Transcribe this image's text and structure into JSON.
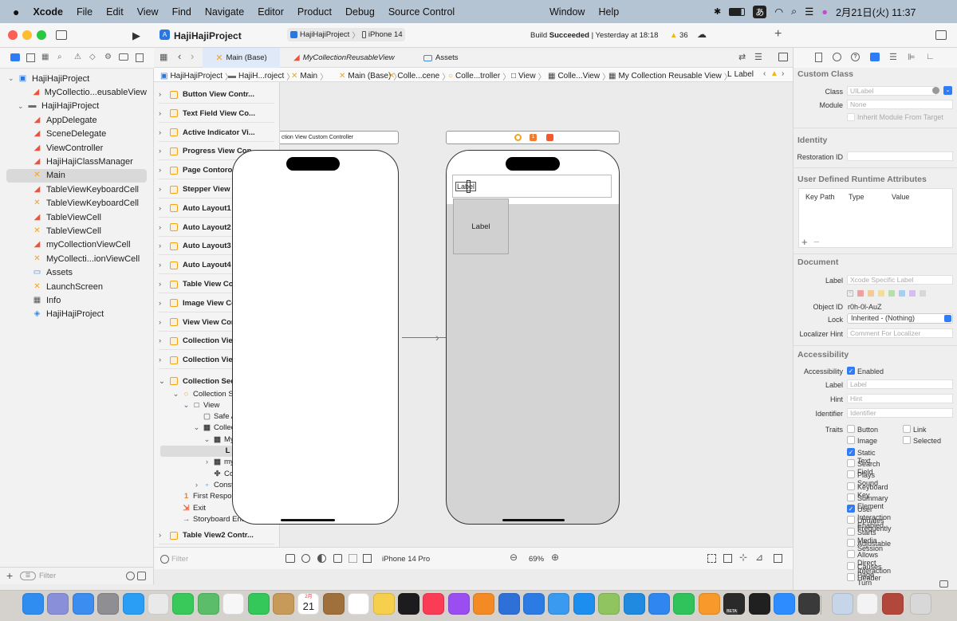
{
  "menubar": {
    "apple": "",
    "app": "Xcode",
    "items": [
      "File",
      "Edit",
      "View",
      "Find",
      "Navigate",
      "Editor",
      "Product",
      "Debug",
      "Source Control",
      "Window",
      "Help"
    ],
    "ime": "あ",
    "clock": "2月21日(火) 11:37"
  },
  "toolbar": {
    "project": "HajiHajiProject",
    "scheme": "HajiHajiProject",
    "device": "iPhone 14",
    "status_prefix": "Build ",
    "status_bold": "Succeeded",
    "status_time": " | Yesterday at 18:18",
    "warnings": "36"
  },
  "navigator": {
    "items": [
      {
        "label": "HajiHajiProject",
        "icon": "project-icon",
        "indent": 0,
        "chevron": "⌄"
      },
      {
        "label": "MyCollectio...eusableView",
        "icon": "swift-file-icon",
        "indent": 2
      },
      {
        "label": "HajiHajiProject",
        "icon": "folder-icon",
        "indent": 1,
        "chevron": "⌄"
      },
      {
        "label": "AppDelegate",
        "icon": "swift-file-icon",
        "indent": 2
      },
      {
        "label": "SceneDelegate",
        "icon": "swift-file-icon",
        "indent": 2
      },
      {
        "label": "ViewController",
        "icon": "swift-file-icon",
        "indent": 2
      },
      {
        "label": "HajiHajiClassManager",
        "icon": "swift-file-icon",
        "indent": 2
      },
      {
        "label": "Main",
        "icon": "storyboard-icon",
        "indent": 2,
        "selected": true
      },
      {
        "label": "TableViewKeyboardCell",
        "icon": "swift-file-icon",
        "indent": 2
      },
      {
        "label": "TableViewKeyboardCell",
        "icon": "storyboard-icon",
        "indent": 2
      },
      {
        "label": "TableViewCell",
        "icon": "swift-file-icon",
        "indent": 2
      },
      {
        "label": "TableViewCell",
        "icon": "storyboard-icon",
        "indent": 2
      },
      {
        "label": "myCollectionViewCell",
        "icon": "swift-file-icon",
        "indent": 2
      },
      {
        "label": "MyCollecti...ionViewCell",
        "icon": "storyboard-icon",
        "indent": 2
      },
      {
        "label": "Assets",
        "icon": "assets-icon",
        "indent": 2
      },
      {
        "label": "LaunchScreen",
        "icon": "storyboard-icon",
        "indent": 2
      },
      {
        "label": "Info",
        "icon": "table-icon",
        "indent": 2
      },
      {
        "label": "HajiHajiProject",
        "icon": "project-file-icon",
        "indent": 2
      }
    ],
    "filter_placeholder": "Filter"
  },
  "tabs": [
    {
      "label": "Main (Base)",
      "active": true
    },
    {
      "label": "MyCollectionReusableView",
      "active": false
    },
    {
      "label": "Assets",
      "active": false
    }
  ],
  "breadcrumb": [
    "HajiHajiProject",
    "HajiH...roject",
    "Main",
    "Main (Base)",
    "Colle...cene",
    "Colle...troller",
    "View",
    "Colle...View",
    "My Collection Reusable View",
    "Label"
  ],
  "outline": {
    "scenes": [
      "Button View Contr...",
      "Text Field View Co...",
      "Active Indicator Vi...",
      "Progress View Con...",
      "Page Contorol Vie...",
      "Stepper View Cont...",
      "Auto Layout1 View...",
      "Auto Layout2 View...",
      "Auto Layout3 View...",
      "Auto Layout4 View...",
      "Table View Control...",
      "Image View Contro...",
      "View View Controll...",
      "Collection View St...",
      "Collection View Cu..."
    ],
    "expanded": "Collection Section...",
    "tree": [
      {
        "label": "Collection Secti...",
        "level": 1,
        "chevron": "⌄",
        "icon": "vc-icon"
      },
      {
        "label": "View",
        "level": 2,
        "chevron": "⌄",
        "icon": "view-icon"
      },
      {
        "label": "Safe Area",
        "level": 3,
        "icon": "safe-area-icon"
      },
      {
        "label": "Collection...",
        "level": 3,
        "chevron": "⌄",
        "icon": "collection-icon"
      },
      {
        "label": "My Coll...",
        "level": 4,
        "chevron": "⌄",
        "icon": "collection-icon"
      },
      {
        "label": "Label",
        "level": 5,
        "icon": "label-icon",
        "selected": true
      },
      {
        "label": "myColl...",
        "level": 4,
        "chevron": "›",
        "icon": "collection-icon"
      },
      {
        "label": "Collect...",
        "level": 4,
        "icon": "layout-icon"
      },
      {
        "label": "Constraints",
        "level": 3,
        "chevron": "›",
        "icon": "constraints-icon"
      },
      {
        "label": "First Responder",
        "level": 1,
        "icon": "first-responder-icon"
      },
      {
        "label": "Exit",
        "level": 1,
        "icon": "exit-icon"
      },
      {
        "label": "Storyboard Entr...",
        "level": 1,
        "icon": "entry-icon"
      }
    ],
    "last": "Table View2 Contr..."
  },
  "canvas": {
    "left_title": "ction View Custom Controller",
    "header_label": "Label",
    "cell_label": "Label"
  },
  "canvas_bottom": {
    "filter_placeholder": "Filter",
    "device": "iPhone 14 Pro",
    "zoom": "69%"
  },
  "inspector": {
    "custom_class": {
      "title": "Custom Class",
      "class_label": "Class",
      "class_placeholder": "UILabel",
      "module_label": "Module",
      "module_placeholder": "None",
      "inherit": "Inherit Module From Target"
    },
    "identity": {
      "title": "Identity",
      "restoration_label": "Restoration ID"
    },
    "runtime": {
      "title": "User Defined Runtime Attributes",
      "columns": [
        "Key Path",
        "Type",
        "Value"
      ]
    },
    "document": {
      "title": "Document",
      "label_label": "Label",
      "label_placeholder": "Xcode Specific Label",
      "object_id_label": "Object ID",
      "object_id": "r0h-0l-AuZ",
      "lock_label": "Lock",
      "lock_value": "Inherited - (Nothing)",
      "localizer_label": "Localizer Hint",
      "localizer_placeholder": "Comment For Localizer",
      "colors": [
        "#f26b6b",
        "#f5b35a",
        "#f4d35a",
        "#8fd37a",
        "#7ab6f2",
        "#c29bf0",
        "#c8c8c8"
      ]
    },
    "accessibility": {
      "title": "Accessibility",
      "acc_label": "Accessibility",
      "enabled": "Enabled",
      "label_label": "Label",
      "label_placeholder": "Label",
      "hint_label": "Hint",
      "hint_placeholder": "Hint",
      "identifier_label": "Identifier",
      "identifier_placeholder": "Identifier",
      "traits_label": "Traits",
      "traits_col1": [
        {
          "t": "Button",
          "on": false
        },
        {
          "t": "Image",
          "on": false
        },
        {
          "t": "Static Text",
          "on": true
        },
        {
          "t": "Search Field",
          "on": false
        },
        {
          "t": "Plays Sound",
          "on": false
        },
        {
          "t": "Keyboard Key",
          "on": false
        },
        {
          "t": "Summary Element",
          "on": false
        },
        {
          "t": "User Interaction Enabled",
          "on": true
        },
        {
          "t": "Updates Frequently",
          "on": false
        },
        {
          "t": "Starts Media Session",
          "on": false
        },
        {
          "t": "Adjustable",
          "on": false
        },
        {
          "t": "Allows Direct Interaction",
          "on": false
        },
        {
          "t": "Causes Page Turn",
          "on": false
        },
        {
          "t": "Header",
          "on": false
        }
      ],
      "traits_col2": [
        {
          "t": "Link",
          "on": false
        },
        {
          "t": "Selected",
          "on": false
        }
      ]
    }
  },
  "dock": {
    "calendar_month": "2月",
    "calendar_day": "21",
    "beta": "BETA",
    "apps": [
      {
        "name": "finder",
        "c": "#2f8cf0"
      },
      {
        "name": "launchpad",
        "c": "#8a8fd9"
      },
      {
        "name": "mail",
        "c": "#3b8df0"
      },
      {
        "name": "system-settings",
        "c": "#8e8e93"
      },
      {
        "name": "safari",
        "c": "#2a9df4"
      },
      {
        "name": "chrome",
        "c": "#e9e9e9"
      },
      {
        "name": "messages",
        "c": "#39c85a"
      },
      {
        "name": "maps",
        "c": "#5bbd6a"
      },
      {
        "name": "photos",
        "c": "#f7f7f7"
      },
      {
        "name": "facetime",
        "c": "#34c759"
      },
      {
        "name": "contacts",
        "c": "#c89a5a"
      },
      {
        "name": "calendar",
        "c": "#ffffff"
      },
      {
        "name": "notebook",
        "c": "#a0703c"
      },
      {
        "name": "reminders",
        "c": "#ffffff"
      },
      {
        "name": "notes",
        "c": "#f6d04d"
      },
      {
        "name": "tv",
        "c": "#1c1c1e"
      },
      {
        "name": "music",
        "c": "#fa3c55"
      },
      {
        "name": "podcasts",
        "c": "#9a4df0"
      },
      {
        "name": "books",
        "c": "#f48a24"
      },
      {
        "name": "xcode-beta",
        "c": "#2f6fd8"
      },
      {
        "name": "instruments",
        "c": "#2c7be5"
      },
      {
        "name": "simulator",
        "c": "#3a9af0"
      },
      {
        "name": "app-store",
        "c": "#1c8ef0"
      },
      {
        "name": "sketch",
        "c": "#8fc460"
      },
      {
        "name": "vscode",
        "c": "#1f8ae0"
      },
      {
        "name": "keynote",
        "c": "#2f86f0"
      },
      {
        "name": "numbers",
        "c": "#30c25b"
      },
      {
        "name": "pages",
        "c": "#f7992b"
      },
      {
        "name": "github",
        "c": "#2a2a2a"
      },
      {
        "name": "terminal",
        "c": "#202020"
      },
      {
        "name": "zoom",
        "c": "#2d8cff"
      },
      {
        "name": "calculator",
        "c": "#3a3a3a"
      },
      {
        "name": "preview",
        "c": "#c7d5e8"
      },
      {
        "name": "textedit",
        "c": "#f3f3f3"
      },
      {
        "name": "dictionary",
        "c": "#b2473b"
      },
      {
        "name": "trash",
        "c": "#d8d8d8"
      }
    ]
  }
}
